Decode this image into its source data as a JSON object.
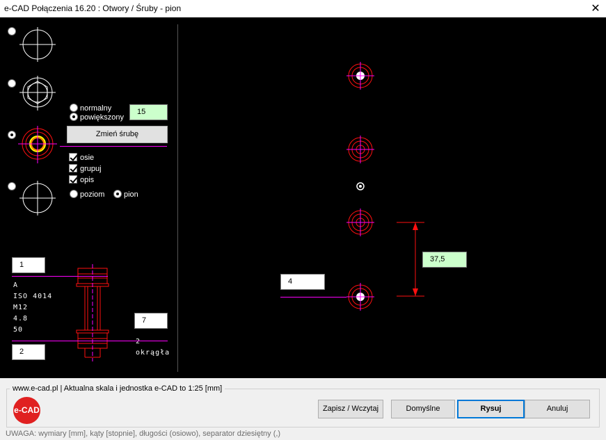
{
  "window": {
    "title": "e-CAD Połączenia 16.20 : Otwory / Śruby - pion",
    "close_glyph": "✕"
  },
  "left_panel": {
    "size_mode": {
      "normal": "normalny",
      "enlarged": "powiększony",
      "selected": "enlarged"
    },
    "enlarge_value": "15",
    "change_bolt_button": "Zmień śrubę",
    "checkboxes": [
      {
        "label": "osie",
        "checked": true
      },
      {
        "label": "grupuj",
        "checked": true
      },
      {
        "label": "opis",
        "checked": true
      }
    ],
    "orientation": {
      "horizontal": "poziom",
      "vertical": "pion",
      "selected": "vertical"
    },
    "selected_hole_type": 3
  },
  "bolt": {
    "top_field": "1",
    "bottom_field": "2",
    "right_field": "7",
    "desc_lines": [
      "A",
      "ISO 4014",
      "M12",
      "4.8",
      "50"
    ],
    "right_note_lines": [
      "2",
      "okrągła"
    ]
  },
  "preview": {
    "count_field": "4",
    "spacing_field": "37,5"
  },
  "colors": {
    "red": "#ff1010",
    "magenta": "#ff00ff",
    "white": "#ffffff",
    "yellow": "#ffff00"
  },
  "bottom": {
    "group_title": "www.e-cad.pl | Aktualna skala i jednostka e-CAD to 1:25 [mm]",
    "logo_text": "e-CAD",
    "buttons": {
      "save_load": "Zapisz / Wczytaj",
      "defaults": "Domyślne",
      "draw": "Rysuj",
      "cancel": "Anuluj"
    },
    "note": "UWAGA: wymiary [mm], kąty [stopnie], długości (osiowo), separator dziesiętny (,)"
  }
}
